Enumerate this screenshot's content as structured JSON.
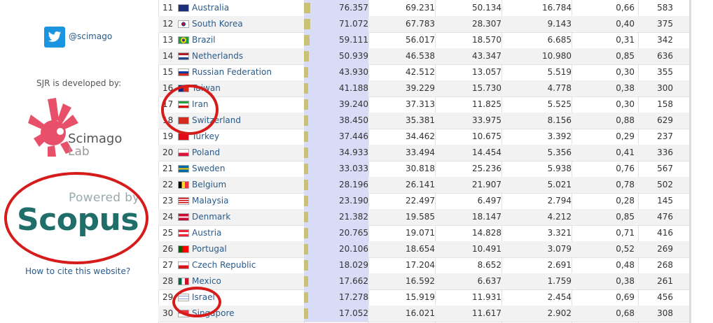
{
  "sidebar": {
    "twitter_handle": "@scimago",
    "developed_by": "SJR is developed by:",
    "scimago_word": "Scimago",
    "lab_word": "Lab",
    "powered_by": "Powered by",
    "scopus_word": "Scopus",
    "cite_link": "How to cite this website?"
  },
  "table": {
    "rows": [
      {
        "rank": "11",
        "country": "Australia",
        "v1": "76.357",
        "v2": "69.231",
        "v3": "50.134",
        "v4": "16.784",
        "v5": "0,66",
        "v6": "583",
        "flag_icon": "australia-flag-icon",
        "bar_fraction": 0.1
      },
      {
        "rank": "12",
        "country": "South Korea",
        "v1": "71.072",
        "v2": "67.783",
        "v3": "28.307",
        "v4": "9.143",
        "v5": "0,40",
        "v6": "375",
        "flag_icon": "south-korea-flag-icon",
        "bar_fraction": 0.1
      },
      {
        "rank": "13",
        "country": "Brazil",
        "v1": "59.111",
        "v2": "56.017",
        "v3": "18.570",
        "v4": "6.685",
        "v5": "0,31",
        "v6": "342",
        "flag_icon": "brazil-flag-icon",
        "bar_fraction": 0.09
      },
      {
        "rank": "14",
        "country": "Netherlands",
        "v1": "50.939",
        "v2": "46.538",
        "v3": "43.347",
        "v4": "10.980",
        "v5": "0,85",
        "v6": "636",
        "flag_icon": "netherlands-flag-icon",
        "bar_fraction": 0.08
      },
      {
        "rank": "15",
        "country": "Russian Federation",
        "v1": "43.930",
        "v2": "42.512",
        "v3": "13.057",
        "v4": "5.519",
        "v5": "0,30",
        "v6": "355",
        "flag_icon": "russia-flag-icon",
        "bar_fraction": 0.07
      },
      {
        "rank": "16",
        "country": "Taiwan",
        "v1": "41.188",
        "v2": "39.229",
        "v3": "15.730",
        "v4": "4.778",
        "v5": "0,38",
        "v6": "300",
        "flag_icon": "taiwan-flag-icon",
        "bar_fraction": 0.07
      },
      {
        "rank": "17",
        "country": "Iran",
        "v1": "39.240",
        "v2": "37.313",
        "v3": "11.825",
        "v4": "5.525",
        "v5": "0,30",
        "v6": "158",
        "flag_icon": "iran-flag-icon",
        "bar_fraction": 0.06
      },
      {
        "rank": "18",
        "country": "Switzerland",
        "v1": "38.450",
        "v2": "35.381",
        "v3": "33.975",
        "v4": "8.156",
        "v5": "0,88",
        "v6": "629",
        "flag_icon": "switzerland-flag-icon",
        "bar_fraction": 0.06
      },
      {
        "rank": "19",
        "country": "Turkey",
        "v1": "37.446",
        "v2": "34.462",
        "v3": "10.675",
        "v4": "3.392",
        "v5": "0,29",
        "v6": "237",
        "flag_icon": "turkey-flag-icon",
        "bar_fraction": 0.06
      },
      {
        "rank": "20",
        "country": "Poland",
        "v1": "34.933",
        "v2": "33.494",
        "v3": "14.454",
        "v4": "5.356",
        "v5": "0,41",
        "v6": "336",
        "flag_icon": "poland-flag-icon",
        "bar_fraction": 0.05
      },
      {
        "rank": "21",
        "country": "Sweden",
        "v1": "33.033",
        "v2": "30.818",
        "v3": "25.236",
        "v4": "5.938",
        "v5": "0,76",
        "v6": "567",
        "flag_icon": "sweden-flag-icon",
        "bar_fraction": 0.05
      },
      {
        "rank": "22",
        "country": "Belgium",
        "v1": "28.196",
        "v2": "26.141",
        "v3": "21.907",
        "v4": "5.021",
        "v5": "0,78",
        "v6": "502",
        "flag_icon": "belgium-flag-icon",
        "bar_fraction": 0.05
      },
      {
        "rank": "23",
        "country": "Malaysia",
        "v1": "23.190",
        "v2": "22.497",
        "v3": "6.497",
        "v4": "2.794",
        "v5": "0,28",
        "v6": "145",
        "flag_icon": "malaysia-flag-icon",
        "bar_fraction": 0.04
      },
      {
        "rank": "24",
        "country": "Denmark",
        "v1": "21.382",
        "v2": "19.585",
        "v3": "18.147",
        "v4": "4.212",
        "v5": "0,85",
        "v6": "476",
        "flag_icon": "denmark-flag-icon",
        "bar_fraction": 0.04
      },
      {
        "rank": "25",
        "country": "Austria",
        "v1": "20.765",
        "v2": "19.071",
        "v3": "14.828",
        "v4": "3.321",
        "v5": "0,71",
        "v6": "416",
        "flag_icon": "austria-flag-icon",
        "bar_fraction": 0.04
      },
      {
        "rank": "26",
        "country": "Portugal",
        "v1": "20.106",
        "v2": "18.654",
        "v3": "10.491",
        "v4": "3.079",
        "v5": "0,52",
        "v6": "269",
        "flag_icon": "portugal-flag-icon",
        "bar_fraction": 0.04
      },
      {
        "rank": "27",
        "country": "Czech Republic",
        "v1": "18.029",
        "v2": "17.204",
        "v3": "8.652",
        "v4": "2.691",
        "v5": "0,48",
        "v6": "268",
        "flag_icon": "czech-flag-icon",
        "bar_fraction": 0.03
      },
      {
        "rank": "28",
        "country": "Mexico",
        "v1": "17.662",
        "v2": "16.592",
        "v3": "6.637",
        "v4": "1.759",
        "v5": "0,38",
        "v6": "261",
        "flag_icon": "mexico-flag-icon",
        "bar_fraction": 0.03
      },
      {
        "rank": "29",
        "country": "Israel",
        "v1": "17.278",
        "v2": "15.919",
        "v3": "11.931",
        "v4": "2.454",
        "v5": "0,69",
        "v6": "456",
        "flag_icon": "israel-flag-icon",
        "bar_fraction": 0.03
      },
      {
        "rank": "30",
        "country": "Singapore",
        "v1": "17.052",
        "v2": "16.021",
        "v3": "11.617",
        "v4": "2.902",
        "v5": "0,68",
        "v6": "308",
        "flag_icon": "singapore-flag-icon",
        "bar_fraction": 0.03
      }
    ]
  },
  "colors": {
    "link": "#2a5b8a",
    "bar_bg": "#d8dcf6",
    "bar_mark": "#c9c178",
    "annotation_red": "#d61b1b",
    "scopus_teal": "#1f6e6a",
    "scimago_pink": "#e8506a"
  }
}
